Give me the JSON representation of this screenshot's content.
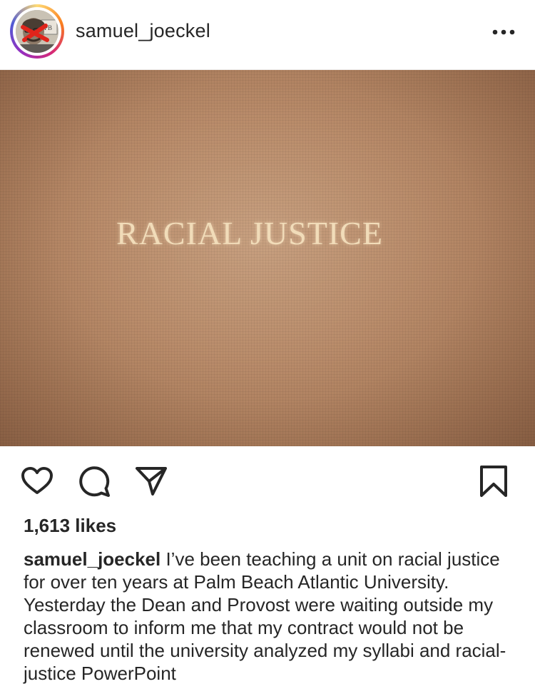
{
  "post": {
    "username": "samuel_joeckel",
    "more_options_icon": "more-horizontal-icon",
    "photo": {
      "text": "RACIAL JUSTICE"
    },
    "actions": {
      "like_icon": "heart-icon",
      "comment_icon": "comment-icon",
      "share_icon": "send-icon",
      "save_icon": "bookmark-icon"
    },
    "likes_text": "1,613 likes",
    "caption": {
      "username": "samuel_joeckel",
      "text": " I’ve been teaching a unit on racial justice for over ten years at Palm Beach Atlantic University. Yesterday the Dean and Provost were waiting outside my classroom to inform me that my contract would not be renewed until the university analyzed my syllabi and racial-justice PowerPoint"
    }
  },
  "colors": {
    "text": "#262626",
    "photo_background": "#b98b69",
    "photo_text": "#f1dcb9"
  }
}
